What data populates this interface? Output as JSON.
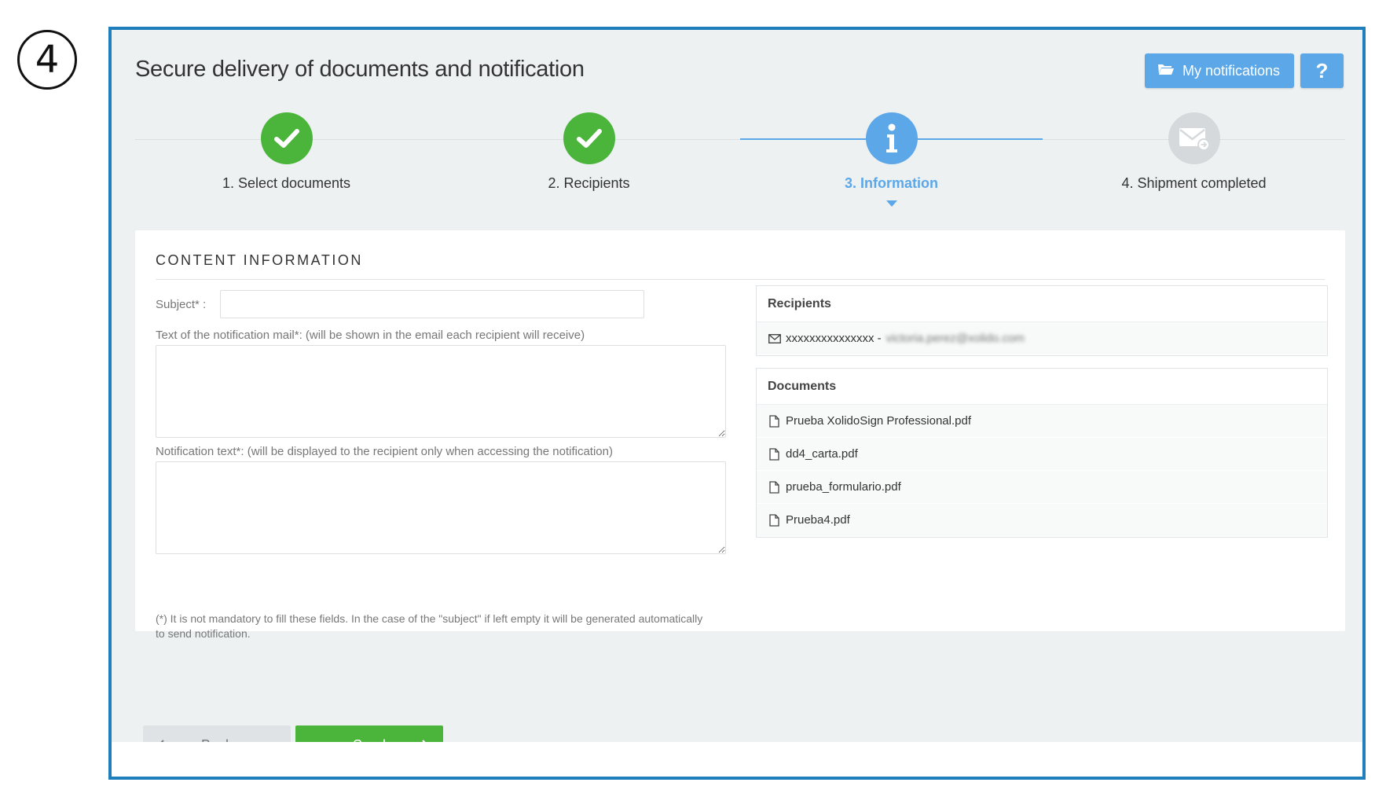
{
  "annotation": {
    "step_number": "4"
  },
  "header": {
    "title": "Secure delivery of documents and notification",
    "notifications_button": "My notifications",
    "help_button": "?"
  },
  "wizard": {
    "steps": [
      {
        "label": "1. Select documents",
        "state": "done"
      },
      {
        "label": "2. Recipients",
        "state": "done"
      },
      {
        "label": "3. Information",
        "state": "active"
      },
      {
        "label": "4. Shipment completed",
        "state": "pending"
      }
    ]
  },
  "form": {
    "section_title": "CONTENT INFORMATION",
    "subject_label": "Subject* :",
    "subject_value": "",
    "mail_text_label": "Text of the notification mail*: (will be shown in the email each recipient will receive)",
    "mail_text_value": "",
    "notification_text_label": "Notification text*: (will be displayed to the recipient only when accessing the notification)",
    "notification_text_value": "",
    "footnote": "(*) It is not mandatory to fill these fields. In the case of the \"subject\" if left empty it will be generated automatically to send notification."
  },
  "recipients": {
    "title": "Recipients",
    "items": [
      {
        "name": "xxxxxxxxxxxxxxx -",
        "email": "victoria.perez@xolido.com"
      }
    ]
  },
  "documents": {
    "title": "Documents",
    "items": [
      "Prueba XolidoSign Professional.pdf",
      "dd4_carta.pdf",
      "prueba_formulario.pdf",
      "Prueba4.pdf"
    ]
  },
  "actions": {
    "back": "Back",
    "send": "Send"
  },
  "colors": {
    "frame_border": "#1f7fbd",
    "primary_blue": "#5ca7e7",
    "success_green": "#4bb53b",
    "background": "#edf1f2"
  },
  "icons": {
    "notifications": "folder-open-icon",
    "step_done": "check-icon",
    "step_active": "info-icon",
    "step_pending": "envelope-arrow-icon",
    "recipient": "envelope-icon",
    "document": "file-icon",
    "back": "chevron-left-icon",
    "send": "chevron-right-icon"
  }
}
